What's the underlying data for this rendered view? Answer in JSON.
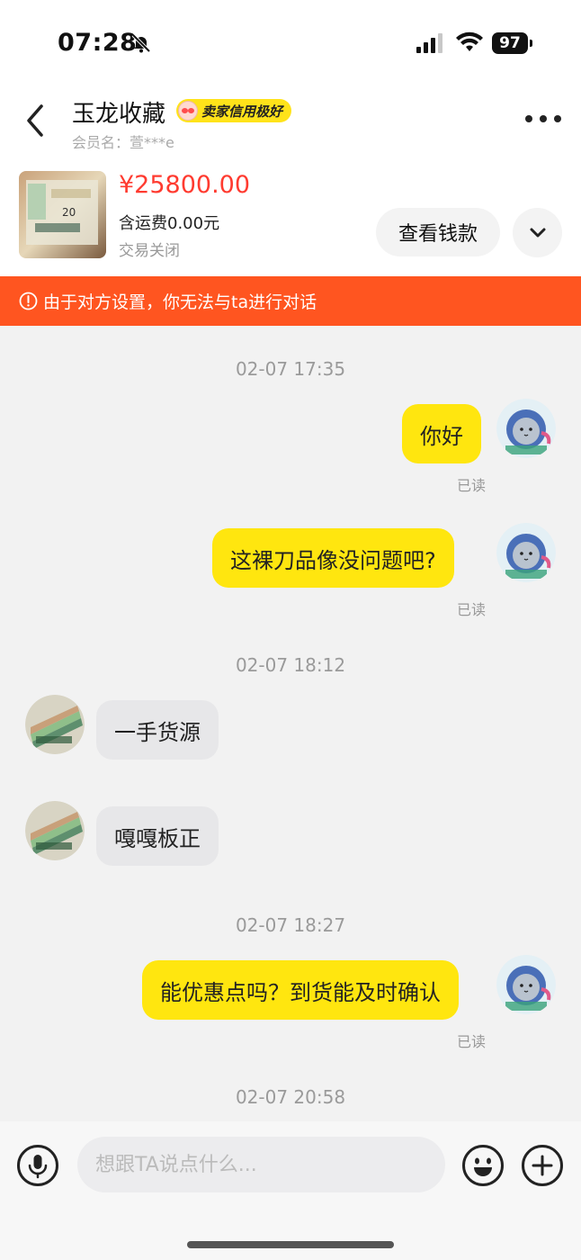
{
  "status_bar": {
    "time": "07:28",
    "battery": "97"
  },
  "header": {
    "shop_name": "玉龙收藏",
    "credit_badge": "卖家信用极好",
    "member": "会员名：萱***e"
  },
  "product": {
    "price": "¥25800.00",
    "shipping": "含运费0.00元",
    "status": "交易关闭",
    "view_button": "查看钱款"
  },
  "warning": "由于对方设置，你无法与ta进行对话",
  "chat": {
    "messages": [
      {
        "type": "time",
        "text": "02-07 17:35"
      },
      {
        "type": "me",
        "text": "你好",
        "read": "已读"
      },
      {
        "type": "me",
        "text": "这裸刀品像没问题吧?",
        "read": "已读"
      },
      {
        "type": "time",
        "text": "02-07 18:12"
      },
      {
        "type": "them",
        "text": "一手货源"
      },
      {
        "type": "them",
        "text": "嘎嘎板正"
      },
      {
        "type": "time",
        "text": "02-07 18:27"
      },
      {
        "type": "me",
        "text": "能优惠点吗？到货能及时确认",
        "read": "已读"
      },
      {
        "type": "time",
        "text": "02-07 20:58"
      }
    ]
  },
  "input": {
    "placeholder": "想跟TA说点什么..."
  },
  "colors": {
    "accent_yellow": "#ffe60f",
    "warning": "#ff5520",
    "price": "#ff3b30"
  }
}
